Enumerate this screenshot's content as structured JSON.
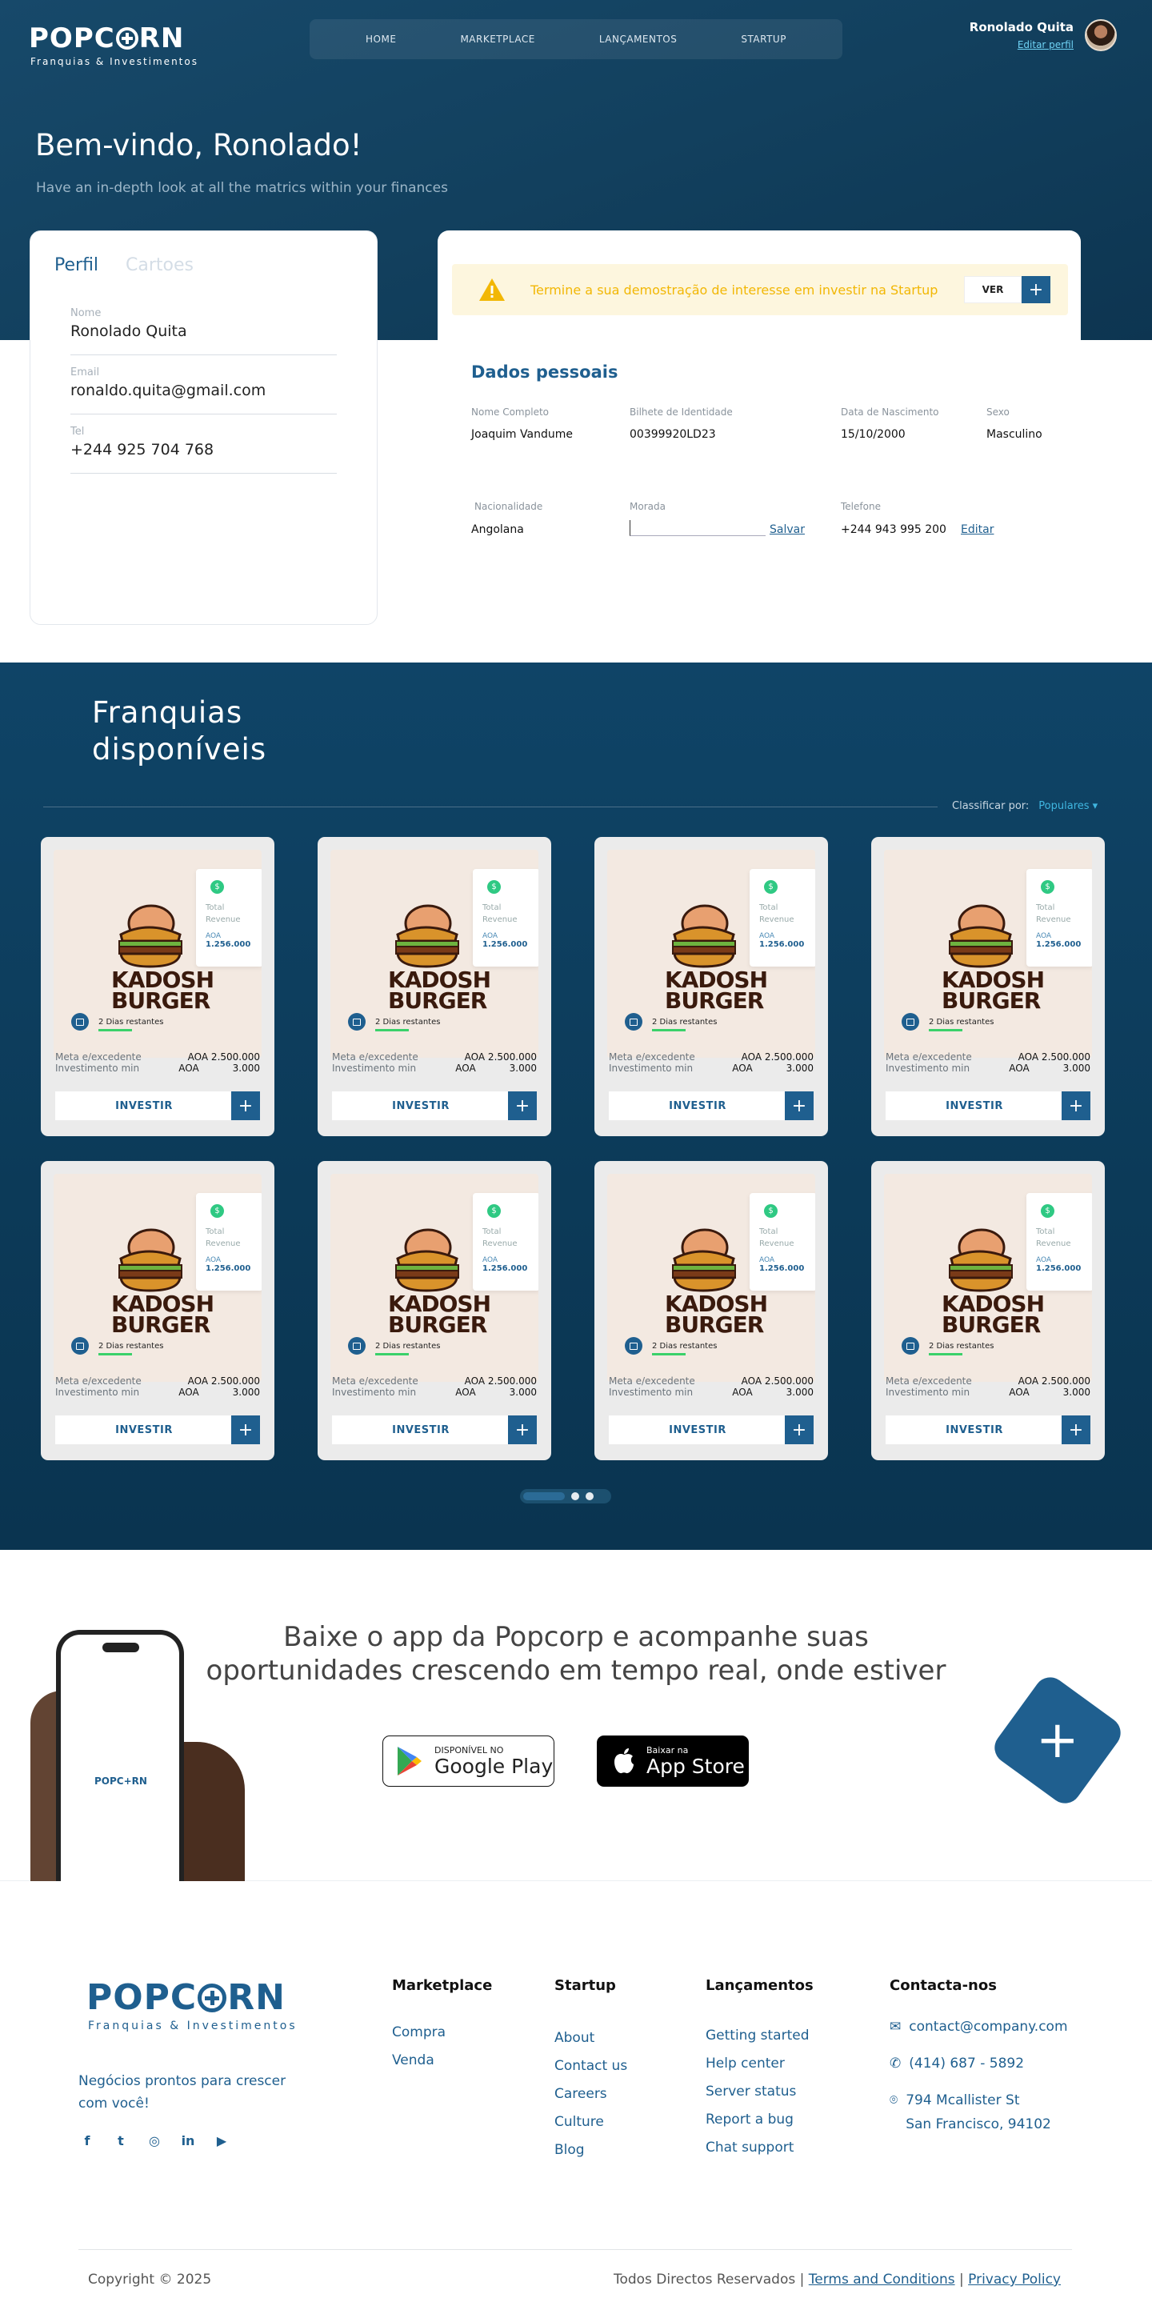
{
  "header": {
    "logo_text_pre": "POPC",
    "logo_text_post": "RN",
    "logo_sub": "Franquias & Investimentos",
    "nav": [
      "HOME",
      "MARKETPLACE",
      "LANÇAMENTOS",
      "STARTUP"
    ],
    "user_name": "Ronolado Quita",
    "edit_profile": "Editar perfil"
  },
  "hero": {
    "welcome": "Bem-vindo, Ronolado!",
    "subtitle": "Have an in-depth look at all the matrics within your finances"
  },
  "profile": {
    "tabs": [
      "Perfil",
      "Cartoes"
    ],
    "fields": [
      {
        "label": "Nome",
        "value": "Ronolado Quita"
      },
      {
        "label": "Email",
        "value": "ronaldo.quita@gmail.com"
      },
      {
        "label": "Tel",
        "value": "+244 925 704 768"
      }
    ]
  },
  "alert": {
    "text": "Termine a sua demostração de interesse em investir na Startup",
    "button": "VER",
    "plus": "+"
  },
  "personal": {
    "title": "Dados pessoais",
    "nome_label": "Nome Completo",
    "nome_value": "Joaquim Vandume",
    "bi_label": "Bilhete de Identidade",
    "bi_value": "00399920LD23",
    "nasc_label": "Data de Nascimento",
    "nasc_value": "15/10/2000",
    "sexo_label": "Sexo",
    "sexo_value": "Masculino",
    "nac_label": "Nacionalidade",
    "nac_value": "Angolana",
    "morada_label": "Morada",
    "save": "Salvar",
    "tel_label": "Telefone",
    "tel_value": "+244 943 995 200",
    "edit": "Editar"
  },
  "franchises": {
    "title_line1": "Franquias",
    "title_line2": "disponíveis",
    "sort_label": "Classificar por:",
    "sort_value": "Populares ▾",
    "card": {
      "brand_line1": "KADOSH",
      "brand_line2": "BURGER",
      "dollar": "$",
      "total_label1": "Total",
      "total_label2": "Revenue",
      "aoa": "AOA",
      "revenue": "1.256.000",
      "days": "2 Dias restantes",
      "meta_label": "Meta e/excedente",
      "meta_value": "AOA 2.500.000",
      "inv_label": "Investimento min",
      "inv_aoa": "AOA",
      "inv_value": "3.000",
      "invest_button": "INVESTIR",
      "plus": "+"
    },
    "card_count": 8
  },
  "app": {
    "title": "Baixe o app da Popcorp e acompanhe suas oportunidades crescendo em tempo real, onde estiver",
    "phone_logo": "POPC+RN",
    "google_small": "DISPONÍVEL NO",
    "google_big": "Google Play",
    "apple_small": "Baixar na",
    "apple_big": "App Store",
    "plus": "+"
  },
  "footer": {
    "tagline": "Negócios prontos para crescer com você!",
    "marketplace_title": "Marketplace",
    "marketplace": [
      "Compra",
      "Venda"
    ],
    "startup_title": "Startup",
    "startup": [
      "About",
      "Contact us",
      "Careers",
      "Culture",
      "Blog"
    ],
    "launch_title": "Lançamentos",
    "launch": [
      "Getting started",
      "Help center",
      "Server status",
      "Report a bug",
      "Chat support"
    ],
    "contact_title": "Contacta-nos",
    "email": "contact@company.com",
    "phone": "(414) 687 - 5892",
    "address_line1": "794 Mcallister St",
    "address_line2": "San Francisco, 94102",
    "copyright": "Copyright © 2025",
    "rights": "Todos Directos Reservados |",
    "terms": "Terms and Conditions",
    "sep": "|",
    "privacy": "Privacy Policy"
  },
  "colors": {
    "primary": "#1f5f8f",
    "hero_bg": "#12405e",
    "alert_text": "#f2b705",
    "accent": "#3fb6e0"
  }
}
